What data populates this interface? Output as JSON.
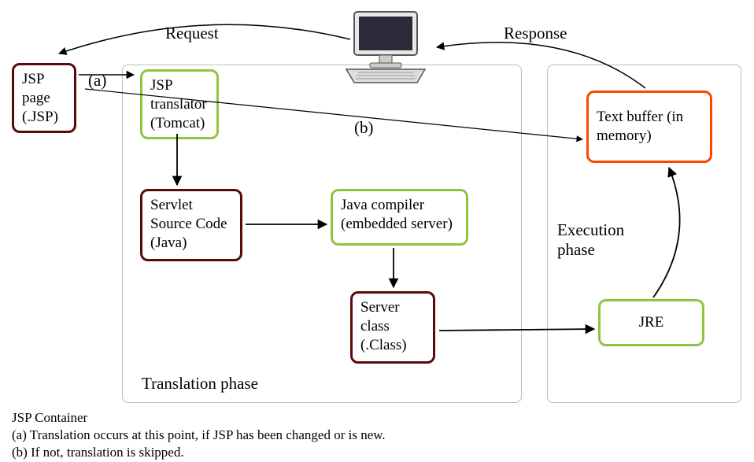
{
  "nodes": {
    "jsp_page": "JSP page (.JSP)",
    "jsp_translator": "JSP translator (Tomcat)",
    "servlet_source": "Servlet Source Code (Java)",
    "java_compiler": "Java compiler (embedded server)",
    "server_class": "Server class (.Class)",
    "jre": "JRE",
    "text_buffer": "Text buffer (in memory)"
  },
  "labels": {
    "request": "Request",
    "response": "Response",
    "a": "(a)",
    "b": "(b)",
    "translation_phase": "Translation phase",
    "execution_phase": "Execution phase"
  },
  "footer": {
    "container": "JSP Container",
    "note_a": "(a) Translation occurs at this point, if JSP has been changed or is new.",
    "note_b": "(b) If not, translation is skipped."
  }
}
